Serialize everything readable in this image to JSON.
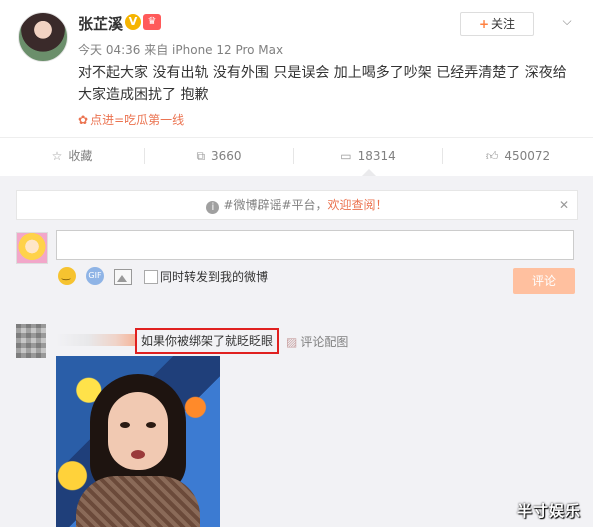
{
  "post": {
    "username": "张芷溪",
    "verified_mark": "V",
    "follow_label": "关注",
    "time": "今天 04:36",
    "source": "来自 iPhone 12 Pro Max",
    "text": "对不起大家 没有出轨 没有外围 只是误会 加上喝多了吵架 已经弄清楚了 深夜给大家造成困扰了 抱歉",
    "topic_link": "点进=吃瓜第一线"
  },
  "actions": {
    "favorite_label": "收藏",
    "repost_count": "3660",
    "comment_count": "18314",
    "like_count": "450072"
  },
  "comment_box": {
    "notice_prefix": "#微博辟谣#平台，",
    "notice_link": "欢迎查阅！",
    "repost_label": "同时转发到我的微博",
    "submit_label": "评论"
  },
  "comments": [
    {
      "text": "如果你被绑架了就眨眨眼",
      "image_link_label": "评论配图"
    }
  ],
  "watermark": "半寸娱乐",
  "colors": {
    "accent": "#eb7350",
    "highlight_border": "#e02020",
    "submit_disabled": "#ffc09f"
  }
}
